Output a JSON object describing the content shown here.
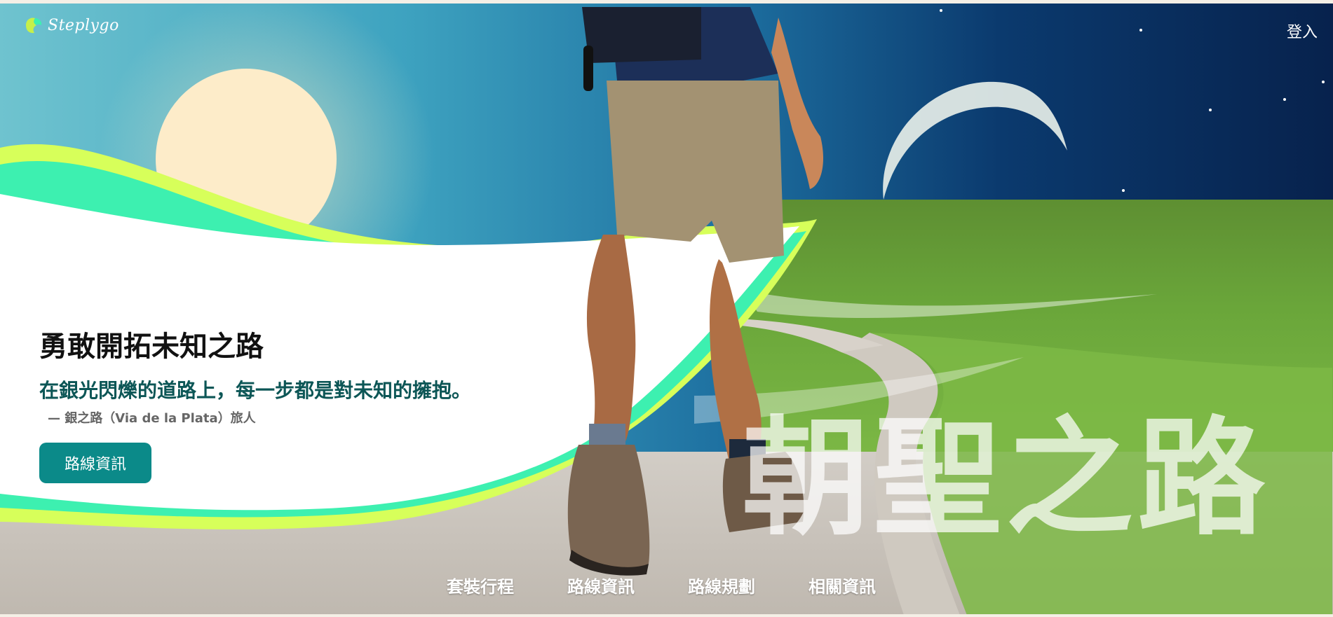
{
  "brand": {
    "name": "Steplygo",
    "accent": "#0b8a89",
    "logo_color": "#c6f04a"
  },
  "header": {
    "login_label": "登入"
  },
  "hero": {
    "headline": "勇敢開拓未知之路",
    "subline": "在銀光閃爍的道路上，每一步都是對未知的擁抱。",
    "attribution": "— 銀之路（Via de la Plata）旅人",
    "cta_label": "路線資訊",
    "big_title": "朝聖之路"
  },
  "nav": {
    "items": [
      {
        "label": "套裝行程"
      },
      {
        "label": "路線資訊"
      },
      {
        "label": "路線規劃"
      },
      {
        "label": "相關資訊"
      }
    ]
  }
}
